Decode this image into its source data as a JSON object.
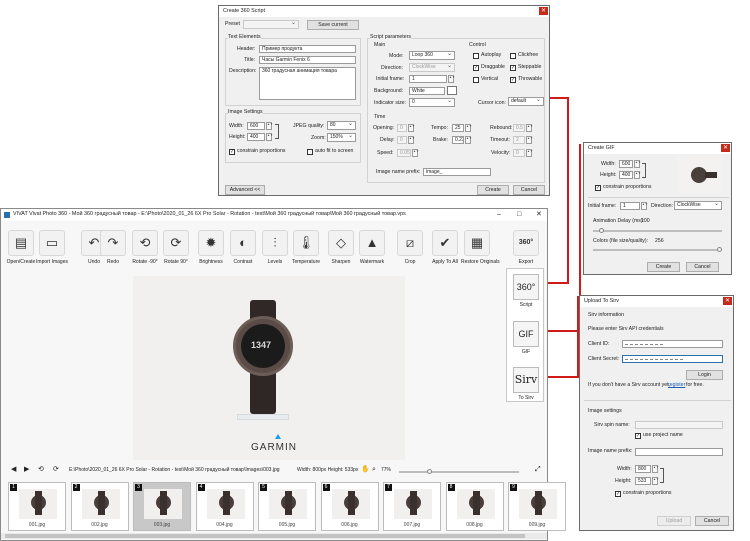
{
  "create360": {
    "title": "Create 360 Script",
    "preset_label": "Preset",
    "preset_value": "",
    "save_current": "Save current",
    "text_elements": "Text Elements",
    "header_label": "Header:",
    "header_value": "Пример продукта",
    "title_label": "Title:",
    "title_value": "Часы Garmin Fenix 6",
    "desc_label": "Description:",
    "desc_value": "360 градусная анимация товара",
    "image_settings": "Image Settings",
    "width_label": "Width:",
    "width_value": "600",
    "height_label": "Height:",
    "height_value": "400",
    "jpeg_label": "JPEG quality:",
    "jpeg_value": "80",
    "zoom_label": "Zoom:",
    "zoom_value": "150%",
    "constrain": "constrain proportions",
    "autofit": "auto fit to screen",
    "script_params": "Script parameters",
    "main_label": "Main",
    "mode_label": "Mode:",
    "mode_value": "Loop 360",
    "direction_label": "Direction:",
    "direction_value": "ClockWise",
    "initial_frame_label": "Initial frame:",
    "initial_frame_value": "1",
    "background_label": "Background:",
    "background_value": "White",
    "indicator_label": "Indicator size:",
    "indicator_value": "0",
    "control_label": "Control",
    "autoplay": "Autoplay",
    "clickfree": "Clickfree",
    "draggable": "Draggable",
    "steppable": "Steppable",
    "vertical": "Vertical",
    "throwable": "Throwable",
    "cursor_label": "Cursor icon:",
    "cursor_value": "default",
    "time_label": "Time",
    "opening_label": "Opening:",
    "opening_value": "0",
    "tempo_label": "Tempo:",
    "tempo_value": "25",
    "rebound_label": "Rebound:",
    "rebound_value": "0.5",
    "delay_label": "Delay:",
    "delay_value": "0",
    "brake_label": "Brake:",
    "brake_value": "0.23",
    "timeout_label": "Timeout:",
    "timeout_value": "2",
    "speed_label": "Speed:",
    "speed_value": "0.05",
    "velocity_label": "Velocity:",
    "velocity_value": "0",
    "prefix_label": "Image name prefix:",
    "prefix_value": "image_",
    "advanced": "Advanced <<",
    "create": "Create",
    "cancel": "Cancel"
  },
  "main": {
    "title": "VIVAT Vivat Photo 360 - Мой 360 градусный товар - E:\\Photo\\2020_01_26 6X Pro Solar - Rotation - test\\Мой 360 градусный товар\\Мой 360 градусный товар.vps",
    "tools": [
      {
        "label": "Open/Create",
        "glyph": "▤"
      },
      {
        "label": "Import Images",
        "glyph": "▭"
      },
      {
        "label": "Undo",
        "glyph": "↶"
      },
      {
        "label": "Redo",
        "glyph": "↷"
      },
      {
        "label": "Rotate -90°",
        "glyph": "⟲"
      },
      {
        "label": "Rotate 90°",
        "glyph": "⟳"
      },
      {
        "label": "Brightness",
        "glyph": "✹"
      },
      {
        "label": "Contrast",
        "glyph": "◐"
      },
      {
        "label": "Levels",
        "glyph": "⫶"
      },
      {
        "label": "Temperature",
        "glyph": "🌡"
      },
      {
        "label": "Sharpen",
        "glyph": "◇"
      },
      {
        "label": "Watermark",
        "glyph": "▲"
      },
      {
        "label": "Crop",
        "glyph": "⧄"
      },
      {
        "label": "Apply To All",
        "glyph": "✔"
      },
      {
        "label": "Restore Originals",
        "glyph": "▦"
      },
      {
        "label": "Export",
        "glyph": "360°"
      }
    ],
    "right_tools": [
      {
        "label": "Script",
        "glyph": "360°"
      },
      {
        "label": "GIF",
        "glyph": "GIF"
      },
      {
        "label": "To Sirv",
        "glyph": "Sirv"
      }
    ],
    "brand": "GARMIN",
    "dial": "1347",
    "status_path": "E:\\Photo\\2020_01_26 6X Pro Solar - Rotation - test\\Мой 360 градусный товар\\Images\\003.jpg",
    "status_size": "Width: 800px Height: 533px",
    "zoom": "77%",
    "thumbs": [
      {
        "num": "1",
        "file": "001.jpg"
      },
      {
        "num": "2",
        "file": "002.jpg"
      },
      {
        "num": "3",
        "file": "003.jpg"
      },
      {
        "num": "4",
        "file": "004.jpg"
      },
      {
        "num": "5",
        "file": "005.jpg"
      },
      {
        "num": "6",
        "file": "006.jpg"
      },
      {
        "num": "7",
        "file": "007.jpg"
      },
      {
        "num": "8",
        "file": "008.jpg"
      },
      {
        "num": "9",
        "file": "009.jpg"
      }
    ]
  },
  "gif": {
    "title": "Create GIF",
    "width_label": "Width:",
    "width_value": "600",
    "height_label": "Height:",
    "height_value": "400",
    "constrain": "constrain proportions",
    "initial_label": "Initial frame:",
    "initial_value": "1",
    "direction_label": "Direction:",
    "direction_value": "ClockWise",
    "delay_label": "Animation Delay (ms):",
    "delay_value": "100",
    "colors_label": "Colors (file size/quality):",
    "colors_value": "256",
    "delay_fraction": 0.05,
    "colors_fraction": 1.0,
    "create": "Create",
    "cancel": "Cancel"
  },
  "sirv": {
    "title": "Upload To Sirv",
    "info": "Sirv information",
    "credentials": "Please enter Sirv API credentials",
    "client_id_label": "Client ID:",
    "client_secret_label": "Client Secret:",
    "login": "Login",
    "no_account": "If you don't have a Sirv account yet,",
    "register": "register",
    "for_free": "for free.",
    "image_settings": "Image settings",
    "spin_label": "Sirv spin name:",
    "use_project": "use project name",
    "prefix_label": "Image name prefix:",
    "width_label": "Width:",
    "width_value": "800",
    "height_label": "Height:",
    "height_value": "533",
    "constrain": "constrain proportions",
    "upload": "Upload",
    "cancel": "Cancel"
  },
  "colors": {
    "accent_red": "#d21a1a",
    "close_red": "#c42b1c"
  }
}
